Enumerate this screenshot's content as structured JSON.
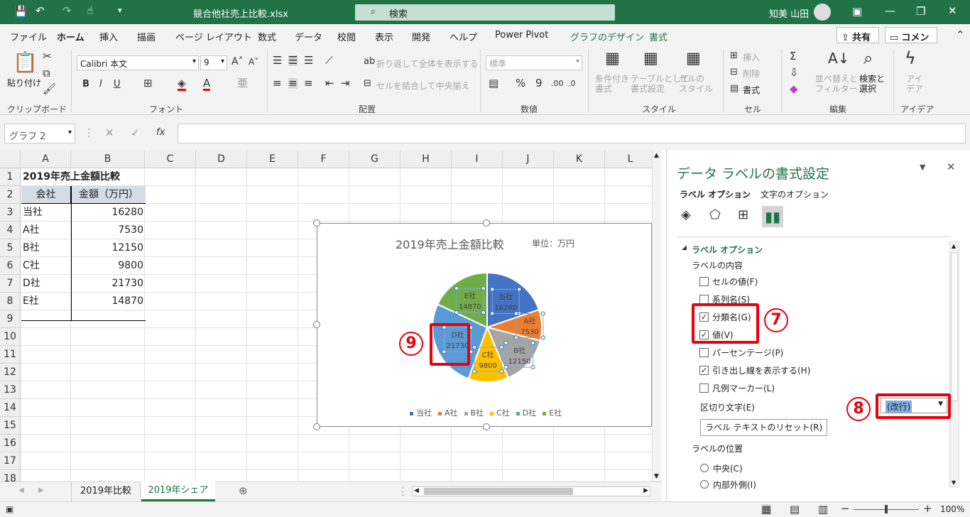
{
  "titlebar": {
    "filename": "競合他社売上比較.xlsx",
    "search_placeholder": "検索",
    "user": "知美 山田"
  },
  "tabs": [
    "ファイル",
    "ホーム",
    "挿入",
    "描画",
    "ページ レイアウト",
    "数式",
    "データ",
    "校閲",
    "表示",
    "開発",
    "ヘルプ",
    "Power Pivot",
    "グラフのデザイン",
    "書式"
  ],
  "share": "共有",
  "comment": "コメント",
  "ribbon": {
    "paste": "貼り付け",
    "font_name": "Calibri 本文",
    "font_size": "9",
    "wrap": "折り返して全体を表示する",
    "merge": "セルを結合して中央揃え",
    "number_format": "標準",
    "cond_format": "条件付き\n書式",
    "table_format": "テーブルとして\n書式設定",
    "cell_style": "セルの\nスタイル",
    "insert": "挿入",
    "delete": "削除",
    "format": "書式",
    "sort": "並べ替えと\nフィルター",
    "find": "検索と\n選択",
    "ideas": "アイ\nデア",
    "groups": [
      "クリップボード",
      "フォント",
      "配置",
      "数値",
      "スタイル",
      "セル",
      "編集",
      "アイデア"
    ]
  },
  "namebox": "グラフ 2",
  "columns": [
    "A",
    "B",
    "C",
    "D",
    "E",
    "F",
    "G",
    "H",
    "I",
    "J",
    "K",
    "L"
  ],
  "rows": [
    "1",
    "2",
    "3",
    "4",
    "5",
    "6",
    "7",
    "8",
    "9",
    "10",
    "11",
    "12",
    "13",
    "14",
    "15",
    "16",
    "17",
    "18"
  ],
  "cells": {
    "a1": "2019年売上金額比較",
    "hdr_company": "会社",
    "hdr_amount": "金額（万円）",
    "data": [
      [
        "当社",
        "16280"
      ],
      [
        "A社",
        "7530"
      ],
      [
        "B社",
        "12150"
      ],
      [
        "C社",
        "9800"
      ],
      [
        "D社",
        "21730"
      ],
      [
        "E社",
        "14870"
      ]
    ]
  },
  "chart_data": {
    "type": "pie",
    "title": "2019年売上金額比較",
    "subtitle": "単位：万円",
    "categories": [
      "当社",
      "A社",
      "B社",
      "C社",
      "D社",
      "E社"
    ],
    "values": [
      16280,
      7530,
      12150,
      9800,
      21730,
      14870
    ],
    "colors": [
      "#4472c4",
      "#ed7d31",
      "#a5a5a5",
      "#ffc000",
      "#5b9bd5",
      "#70ad47"
    ],
    "legend": "bottom"
  },
  "sheet_tabs": [
    "2019年比較",
    "2019年シェア"
  ],
  "pane": {
    "title": "データ ラベルの書式設定",
    "tab_label": "ラベル オプション",
    "tab_text": "文字のオプション",
    "section": "ラベル オプション",
    "contents": "ラベルの内容",
    "options": [
      {
        "label": "セルの値(F)",
        "checked": false
      },
      {
        "label": "系列名(S)",
        "checked": false
      },
      {
        "label": "分類名(G)",
        "checked": true
      },
      {
        "label": "値(V)",
        "checked": true
      },
      {
        "label": "パーセンテージ(P)",
        "checked": false
      },
      {
        "label": "引き出し線を表示する(H)",
        "checked": true
      },
      {
        "label": "凡例マーカー(L)",
        "checked": false
      }
    ],
    "separator_label": "区切り文字(E)",
    "separator_value": "(改行)",
    "reset": "ラベル テキストのリセット(R)",
    "position": "ラベルの位置",
    "pos_center": "中央(C)",
    "pos_inside": "内部外側(I)"
  },
  "badges": [
    "7",
    "8",
    "9"
  ],
  "status": {
    "zoom": "100%"
  }
}
